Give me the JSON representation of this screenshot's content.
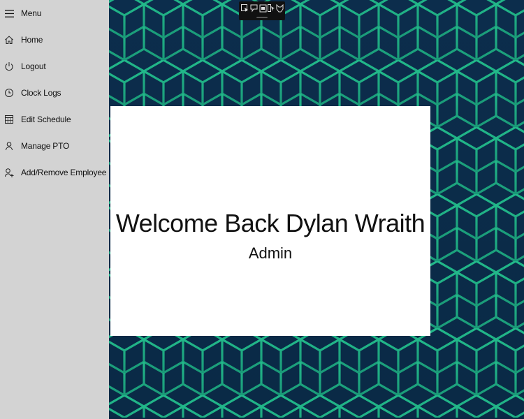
{
  "sidebar": {
    "menu_label": "Menu",
    "items": [
      {
        "label": "Home",
        "icon": "home-icon"
      },
      {
        "label": "Logout",
        "icon": "power-icon"
      },
      {
        "label": "Clock Logs",
        "icon": "clock-icon"
      },
      {
        "label": "Edit Schedule",
        "icon": "calendar-icon"
      },
      {
        "label": "Manage PTO",
        "icon": "person-icon"
      },
      {
        "label": "Add/Remove Employee",
        "icon": "add-person-icon"
      }
    ]
  },
  "toolbar": {
    "buttons": [
      "select-icon",
      "pointer-icon",
      "window-icon",
      "cursor-icon",
      "dog-icon"
    ]
  },
  "welcome": {
    "title": "Welcome Back Dylan Wraith",
    "role": "Admin"
  },
  "colors": {
    "sidebar_bg": "#d3d3d3",
    "background": "#0c2d4c",
    "pattern_line": "#1fa87f",
    "card_bg": "#ffffff"
  }
}
